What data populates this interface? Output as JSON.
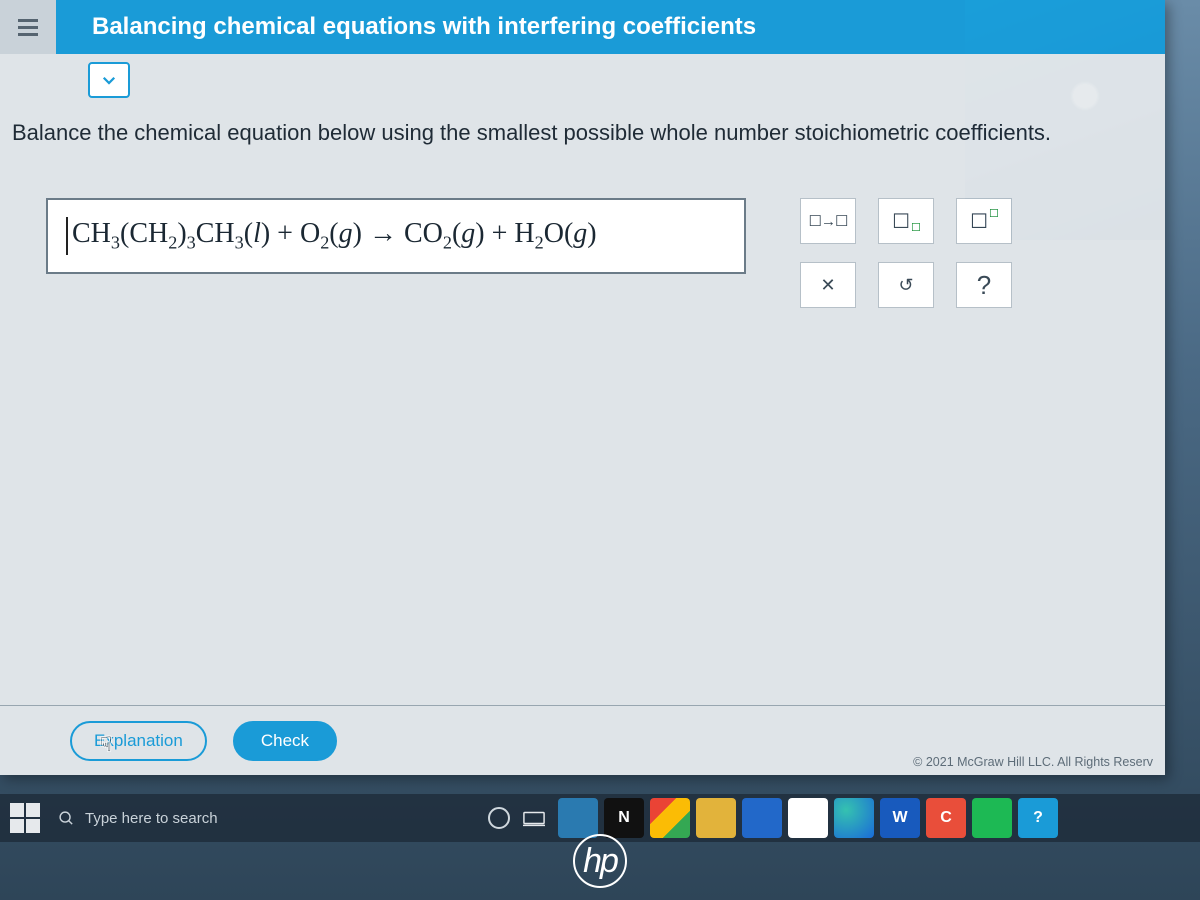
{
  "header": {
    "topic_title": "Balancing chemical equations with interfering coefficients"
  },
  "prompt": "Balance the chemical equation below using the smallest possible whole number stoichiometric coefficients.",
  "equation": {
    "display_html": "CH<sub>3</sub>(CH<sub>2</sub>)<sub>3</sub>CH<sub>3</sub>(<i>l</i>) + O<sub>2</sub>(<i>g</i>) → CO<sub>2</sub>(<i>g</i>) + H<sub>2</sub>O(<i>g</i>)"
  },
  "palette": {
    "arrow_label": "☐→☐",
    "reset_label": "↺",
    "clear_label": "✕",
    "help_label": "?"
  },
  "footer": {
    "explanation_label": "Explanation",
    "check_label": "Check",
    "copyright": "© 2021 McGraw Hill LLC. All Rights Reserv"
  },
  "taskbar": {
    "search_placeholder": "Type here to search",
    "apps": [
      "store",
      "notion",
      "chrome",
      "filex",
      "mail",
      "todo",
      "edge",
      "word",
      "canvas",
      "spotify",
      "help"
    ]
  },
  "brand": {
    "hp": "hp"
  }
}
